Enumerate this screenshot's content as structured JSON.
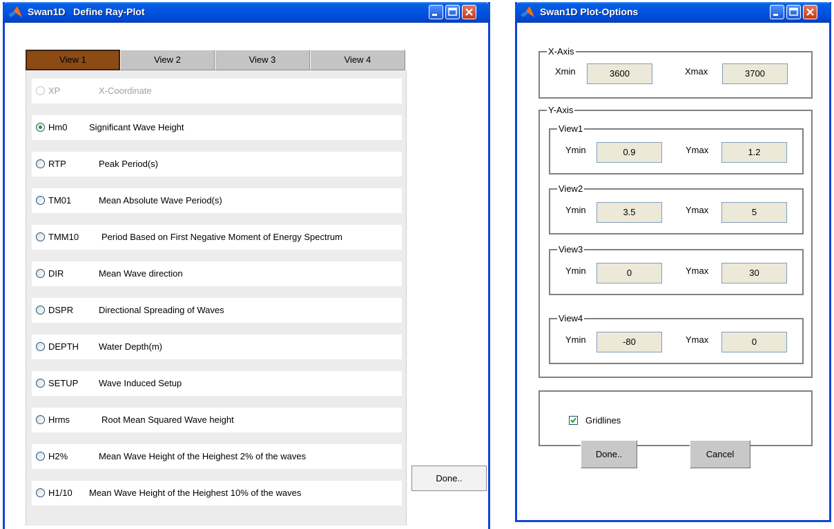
{
  "window1": {
    "title": "Swan1D   Define Ray-Plot",
    "tabs": [
      {
        "label": "View 1",
        "active": true
      },
      {
        "label": "View 2",
        "active": false
      },
      {
        "label": "View 3",
        "active": false
      },
      {
        "label": "View 4",
        "active": false
      }
    ],
    "rows": [
      {
        "code": "XP",
        "desc": "X-Coordinate",
        "checked": false,
        "enabled": false
      },
      {
        "code": "Hm0",
        "desc": "Significant Wave Height",
        "checked": true,
        "enabled": true
      },
      {
        "code": "RTP",
        "desc": "Peak Period(s)",
        "checked": false,
        "enabled": true
      },
      {
        "code": "TM01",
        "desc": "Mean Absolute Wave Period(s)",
        "checked": false,
        "enabled": true
      },
      {
        "code": "TMM10",
        "desc": "Period Based on First Negative Moment of Energy Spectrum",
        "checked": false,
        "enabled": true
      },
      {
        "code": "DIR",
        "desc": "Mean Wave direction",
        "checked": false,
        "enabled": true
      },
      {
        "code": "DSPR",
        "desc": "Directional Spreading of Waves",
        "checked": false,
        "enabled": true
      },
      {
        "code": "DEPTH",
        "desc": "Water Depth(m)",
        "checked": false,
        "enabled": true
      },
      {
        "code": "SETUP",
        "desc": "Wave Induced Setup",
        "checked": false,
        "enabled": true
      },
      {
        "code": "Hrms",
        "desc": "Root Mean Squared Wave height",
        "checked": false,
        "enabled": true
      },
      {
        "code": "H2%",
        "desc": "Mean Wave Height of the Heighest 2% of the waves",
        "checked": false,
        "enabled": true
      },
      {
        "code": "H1/10",
        "desc": "Mean Wave Height of the Heighest 10% of the waves",
        "checked": false,
        "enabled": true
      }
    ],
    "done_label": "Done.."
  },
  "window2": {
    "title": "Swan1D Plot-Options",
    "x_axis": {
      "title": "X-Axis",
      "xmin_label": "Xmin",
      "xmin": "3600",
      "xmax_label": "Xmax",
      "xmax": "3700"
    },
    "y_axis": {
      "title": "Y-Axis",
      "views": [
        {
          "title": "View1",
          "ymin_label": "Ymin",
          "ymin": "0.9",
          "ymax_label": "Ymax",
          "ymax": "1.2"
        },
        {
          "title": "View2",
          "ymin_label": "Ymin",
          "ymin": "3.5",
          "ymax_label": "Ymax",
          "ymax": "5"
        },
        {
          "title": "View3",
          "ymin_label": "Ymin",
          "ymin": "0",
          "ymax_label": "Ymax",
          "ymax": "30"
        },
        {
          "title": "View4",
          "ymin_label": "Ymin",
          "ymin": "-80",
          "ymax_label": "Ymax",
          "ymax": "0"
        }
      ]
    },
    "gridlines": {
      "label": "Gridlines",
      "checked": true
    },
    "done_label": "Done..",
    "cancel_label": "Cancel"
  },
  "colors": {
    "titlebar": "#0054e3",
    "active_tab": "#8c4a14",
    "field_bg": "#ece9d8",
    "check_green": "#21a121"
  },
  "icons": [
    "matlab-logo-icon",
    "minimize-icon",
    "maximize-icon",
    "close-icon",
    "radio-icon",
    "checkbox-icon"
  ]
}
